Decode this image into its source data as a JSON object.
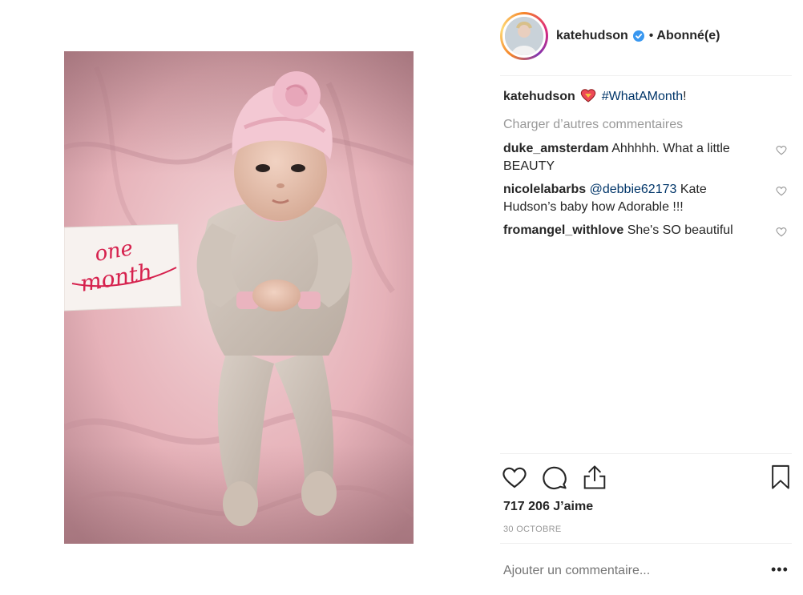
{
  "post": {
    "username": "katehudson",
    "follow_status": "Abonné(e)",
    "separator": "•",
    "photo_card_text": "one month"
  },
  "caption": {
    "username": "katehudson",
    "hashtag": "#WhatAMonth",
    "suffix": "!"
  },
  "load_more": "Charger d’autres commentaires",
  "comments": [
    {
      "username": "duke_amsterdam",
      "text": "Ahhhhh. What a little BEAUTY"
    },
    {
      "username": "nicolelabarbs",
      "mention": "@debbie62173",
      "text": "Kate Hudson’s baby how Adorable !!!"
    },
    {
      "username": "fromangel_withlove",
      "text": "She's SO beautiful"
    }
  ],
  "likes": "717 206 J’aime",
  "date": "30 OCTOBRE",
  "add_comment_placeholder": "Ajouter un commentaire...",
  "more_options": "•••",
  "colors": {
    "link": "#003569",
    "verified": "#3897f0",
    "muted": "#999999",
    "divider": "#efefef"
  },
  "icons": [
    "verified-badge-icon",
    "heart-emoji-icon",
    "heart-icon",
    "comment-icon",
    "share-icon",
    "bookmark-icon"
  ]
}
